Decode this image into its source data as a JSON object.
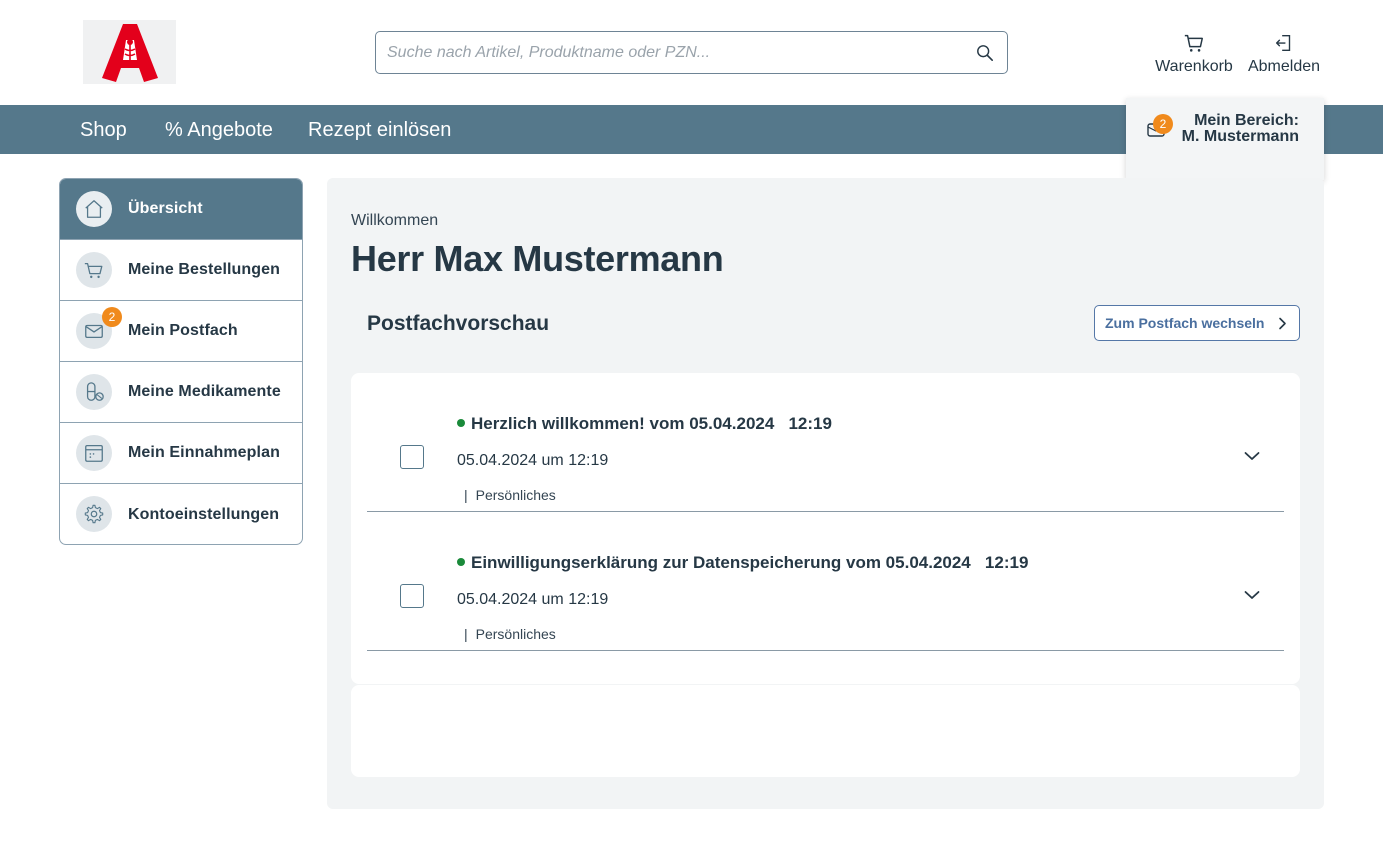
{
  "header": {
    "search_placeholder": "Suche nach Artikel, Produktname oder PZN...",
    "cart_label": "Warenkorb",
    "logout_label": "Abmelden"
  },
  "nav": {
    "items": [
      "Shop",
      "% Angebote",
      "Rezept einlösen"
    ]
  },
  "account": {
    "badge": "2",
    "line1": "Mein Bereich:",
    "line2": "M. Mustermann"
  },
  "sidebar": {
    "items": [
      {
        "label": "Übersicht",
        "icon": "home-icon",
        "active": true
      },
      {
        "label": "Meine Bestellungen",
        "icon": "cart-icon"
      },
      {
        "label": "Mein Postfach",
        "icon": "mail-icon",
        "badge": "2"
      },
      {
        "label": "Meine Medikamente",
        "icon": "pill-icon"
      },
      {
        "label": "Mein Einnahmeplan",
        "icon": "calendar-icon"
      },
      {
        "label": "Kontoeinstellungen",
        "icon": "gear-icon"
      }
    ]
  },
  "main": {
    "welcome": "Willkommen",
    "user_name": "Herr Max Mustermann",
    "preview_title": "Postfachvorschau",
    "postfach_button": "Zum Postfach wechseln",
    "messages": [
      {
        "subject": "Herzlich willkommen! vom 05.04.2024   12:19",
        "date": "05.04.2024 um 12:19",
        "tag": "Persönliches"
      },
      {
        "subject": "Einwilligungserklärung zur Datenspeicherung vom 05.04.2024   12:19",
        "date": "05.04.2024 um 12:19",
        "tag": "Persönliches"
      }
    ]
  },
  "colors": {
    "nav_bg": "#55788b",
    "badge": "#f08a1c",
    "unread_dot": "#1a8a3a",
    "logo_red": "#e3001b"
  }
}
